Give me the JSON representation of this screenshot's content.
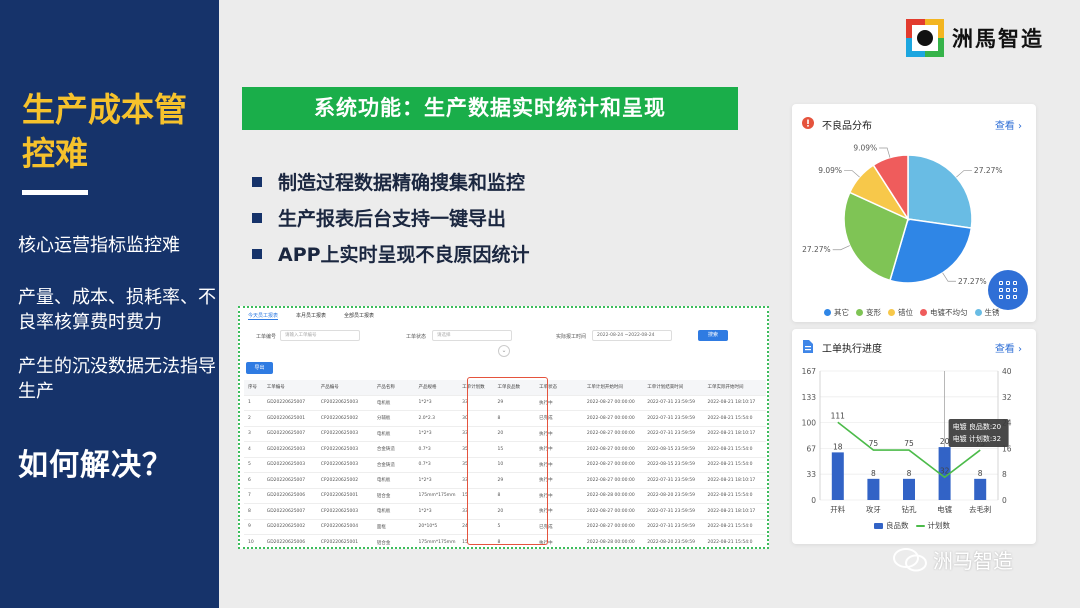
{
  "left": {
    "title": "生产成本管控难",
    "p1": "核心运营指标监控难",
    "p2": "产量、成本、损耗率、不良率核算费时费力",
    "p3": "产生的沉没数据无法指导生产",
    "question": "如何解决？"
  },
  "logo": {
    "text": "洲馬智造"
  },
  "banner": "系统功能：生产数据实时统计和呈现",
  "bullets": [
    "制造过程数据精确搜集和监控",
    "生产报表后台支持一键导出",
    "APP上实时呈现不良原因统计"
  ],
  "table_screen": {
    "tabs": [
      "今天员工报表",
      "本月员工报表",
      "全部员工报表"
    ],
    "filters": {
      "order_label": "工单编号",
      "order_placeholder": "请输入工单编号",
      "status_label": "工单状态",
      "status_placeholder": "请选择",
      "date_label": "实际报工时间",
      "date_value": "2022-08-24 ~2022-08-24",
      "query": "搜索"
    },
    "export": "导出",
    "columns": [
      "序号",
      "工单编号",
      "产品编号",
      "产品名称",
      "产品规格",
      "工单计划数",
      "工单良品数",
      "工单状态",
      "工单计划开始时间",
      "工单计划结束时间",
      "工单实际开始时间"
    ],
    "rows": [
      [
        "1",
        "GD20220625007",
        "CP20220625003",
        "电机板",
        "1*2*3",
        "33",
        "29",
        "执行中",
        "2022-08-27 00:00:00",
        "2022-07-31 23:59:59",
        "2022-08-21 18:10:17"
      ],
      [
        "2",
        "GD20220625001",
        "CP20220625002",
        "分辅板",
        "2.0*2.3",
        "30",
        "8",
        "已完成",
        "2022-08-27 00:00:00",
        "2022-07-31 23:59:59",
        "2022-08-21 15:54:0"
      ],
      [
        "3",
        "GD20220625007",
        "CP20220625003",
        "电机板",
        "1*2*3",
        "33",
        "20",
        "执行中",
        "2022-08-27 00:00:00",
        "2022-07-31 23:59:59",
        "2022-08-21 18:10:17"
      ],
      [
        "4",
        "GD20220625003",
        "CP20220625003",
        "合金铸造",
        "0.7*3",
        "35",
        "15",
        "执行中",
        "2022-08-27 00:00:00",
        "2022-08-15 23:59:59",
        "2022-08-21 15:54:0"
      ],
      [
        "5",
        "GD20220625003",
        "CP20220625003",
        "合金铸造",
        "0.7*3",
        "35",
        "10",
        "执行中",
        "2022-08-27 00:00:00",
        "2022-08-15 23:59:59",
        "2022-08-21 15:54:0"
      ],
      [
        "6",
        "GD20220625007",
        "CP20220625002",
        "电机板",
        "1*2*3",
        "33",
        "29",
        "执行中",
        "2022-08-27 00:00:00",
        "2022-07-31 23:59:59",
        "2022-08-21 18:10:17"
      ],
      [
        "7",
        "GD20220625006",
        "CP20220625001",
        "铝合金",
        "175mm*175mm",
        "15",
        "8",
        "执行中",
        "2022-08-28 00:00:00",
        "2022-08-20 23:59:59",
        "2022-08-21 15:54:0"
      ],
      [
        "8",
        "GD20220625007",
        "CP20220625003",
        "电机板",
        "1*2*3",
        "33",
        "20",
        "执行中",
        "2022-08-27 00:00:00",
        "2022-07-31 23:59:59",
        "2022-08-21 18:10:17"
      ],
      [
        "9",
        "GD20220625002",
        "CP20220625004",
        "面框",
        "20*10*5",
        "24",
        "5",
        "已完成",
        "2022-08-27 00:00:00",
        "2022-07-31 23:59:59",
        "2022-08-21 15:54:0"
      ],
      [
        "10",
        "GD20220625006",
        "CP20220625001",
        "铝合金",
        "175mm*175mm",
        "15",
        "8",
        "执行中",
        "2022-08-28 00:00:00",
        "2022-08-20 23:59:59",
        "2022-08-21 15:54:0"
      ]
    ]
  },
  "pie_card": {
    "title": "不良品分布",
    "link": "查看"
  },
  "bar_card": {
    "title": "工单执行进度",
    "link": "查看",
    "tooltip_title": "电镀",
    "tooltip_good": "良品数:20",
    "tooltip_plan": "计划数:32"
  },
  "chart_data": [
    {
      "type": "pie",
      "title": "不良品分布",
      "labels": [
        "其它",
        "变形",
        "错位",
        "电镀不均匀",
        "生锈"
      ],
      "values": [
        27.27,
        27.27,
        9.09,
        9.09,
        27.27
      ],
      "value_labels": [
        "27.27%",
        "27.27%",
        "9.09%",
        "9.09%",
        "27.27%"
      ],
      "colors": [
        "#2f86e6",
        "#7fc455",
        "#f7c84a",
        "#ef5c5c",
        "#69bce4"
      ],
      "legend_position": "bottom"
    },
    {
      "type": "bar",
      "title": "工单执行进度",
      "categories": [
        "开料",
        "攻牙",
        "钻孔",
        "电镀",
        "去毛刺"
      ],
      "series": [
        {
          "name": "良品数",
          "type": "bar",
          "values": [
            18,
            8,
            8,
            20,
            8
          ],
          "color": "#3263c6",
          "axis": "left"
        },
        {
          "name": "计划数",
          "type": "line",
          "values": [
            111,
            75,
            75,
            32,
            75
          ],
          "color": "#4cbb4a",
          "axis": "left"
        }
      ],
      "y_left": {
        "ticks": [
          "0",
          "33",
          "67",
          "100",
          "133",
          "167"
        ],
        "ylim": [
          0,
          167
        ]
      },
      "y_right": {
        "ticks": [
          "0",
          "8",
          "16",
          "24",
          "32",
          "40"
        ],
        "ylim": [
          0,
          40
        ]
      },
      "legend_position": "bottom",
      "highlighted_category": "电镀"
    }
  ]
}
